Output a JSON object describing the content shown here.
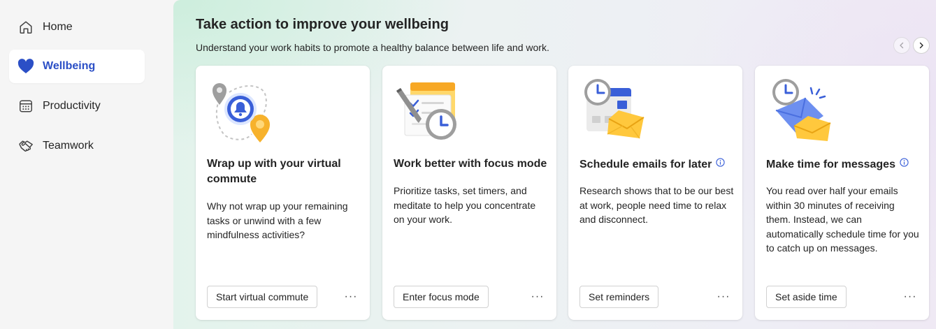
{
  "sidebar": {
    "items": [
      {
        "label": "Home",
        "icon": "home-icon",
        "active": false
      },
      {
        "label": "Wellbeing",
        "icon": "heart-icon",
        "active": true
      },
      {
        "label": "Productivity",
        "icon": "calendar-icon",
        "active": false
      },
      {
        "label": "Teamwork",
        "icon": "handshake-icon",
        "active": false
      }
    ]
  },
  "main": {
    "title": "Take action to improve your wellbeing",
    "subtitle": "Understand your work habits to promote a healthy balance between life and work.",
    "carousel": {
      "prev_icon": "chevron-left-icon",
      "next_icon": "chevron-right-icon"
    },
    "cards": [
      {
        "title": "Wrap up with your virtual commute",
        "description": "Why not wrap up your remaining tasks or unwind with a few mindfulness activities?",
        "button": "Start virtual commute",
        "more": "···",
        "illustration": "commute-illustration"
      },
      {
        "title": "Work better with focus mode",
        "description": "Prioritize tasks, set timers, and meditate to help you concentrate on your work.",
        "button": "Enter focus mode",
        "more": "···",
        "illustration": "focus-illustration"
      },
      {
        "title": "Schedule emails for later",
        "description": "Research shows that to be our best at work, people need time to relax and disconnect.",
        "button": "Set reminders",
        "more": "···",
        "illustration": "schedule-email-illustration",
        "info_icon": "info-icon"
      },
      {
        "title": "Make time for messages",
        "description": "You read over half your emails within 30 minutes of receiving them. Instead, we can automatically schedule time for you to catch up on messages.",
        "button": "Set aside time",
        "more": "···",
        "illustration": "messages-illustration",
        "info_icon": "info-icon"
      }
    ]
  },
  "colors": {
    "accent": "#2b4fc6",
    "card_bg": "#ffffff",
    "sidebar_bg": "#f5f5f5",
    "clock_blue": "#3a5fd8",
    "envelope_yellow": "#ffc83d"
  }
}
